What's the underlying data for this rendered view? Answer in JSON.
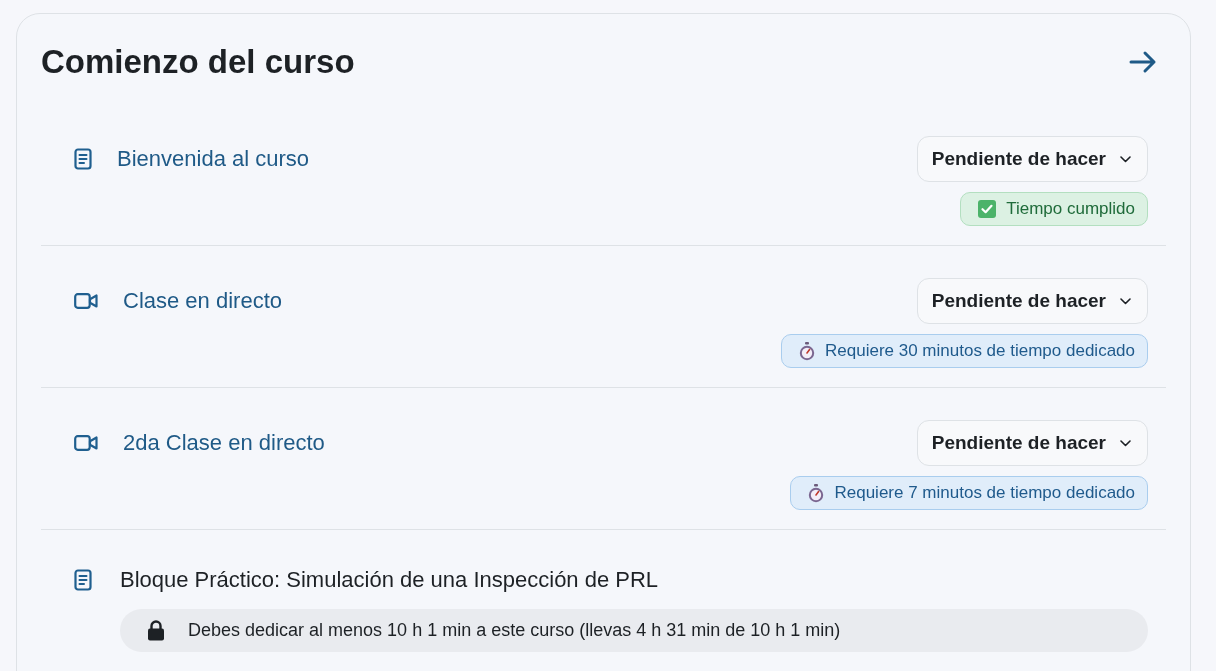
{
  "section": {
    "title": "Comienzo del curso"
  },
  "activities": [
    {
      "kind": "page",
      "title": "Bienvenida al curso",
      "locked": false,
      "completion": "Pendiente de hacer",
      "requirement": {
        "kind": "done",
        "label": "Tiempo cumplido"
      }
    },
    {
      "kind": "video",
      "title": "Clase en directo",
      "locked": false,
      "completion": "Pendiente de hacer",
      "requirement": {
        "kind": "pending",
        "label": "Requiere 30 minutos de tiempo dedicado"
      }
    },
    {
      "kind": "video",
      "title": "2da Clase en directo",
      "locked": false,
      "completion": "Pendiente de hacer",
      "requirement": {
        "kind": "pending",
        "label": "Requiere 7 minutos de tiempo dedicado"
      }
    },
    {
      "kind": "page",
      "title": "Bloque Práctico: Simulación de una Inspección de PRL",
      "locked": true,
      "restriction": "Debes dedicar al menos 10 h 1 min a este curso (llevas 4 h 31 min de 10 h 1 min)"
    }
  ]
}
